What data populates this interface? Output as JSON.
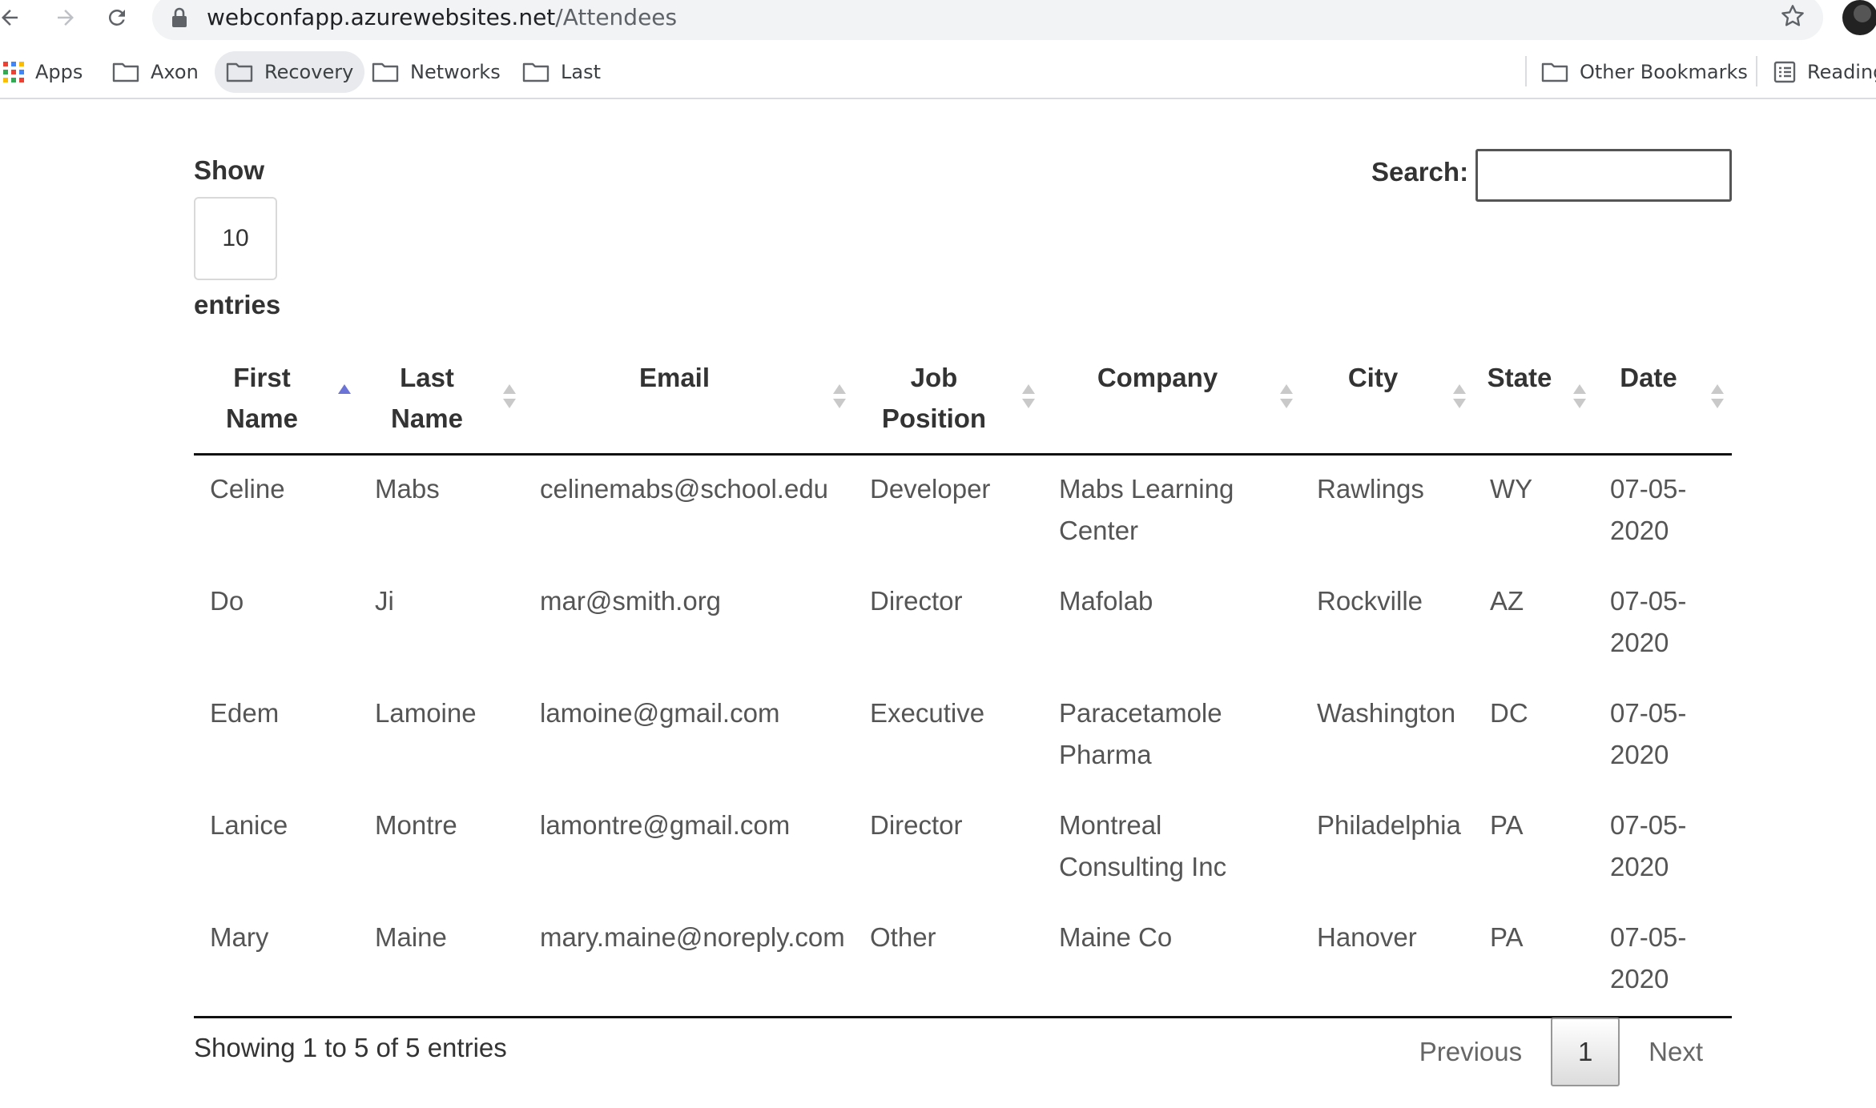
{
  "browser": {
    "url_host": "webconfapp.azurewebsites.net",
    "url_path": "/Attendees"
  },
  "bookmarks": {
    "items": [
      {
        "label": "Apps",
        "icon": "apps-grid-icon"
      },
      {
        "label": "Axon",
        "icon": "folder-icon"
      },
      {
        "label": "Recovery",
        "icon": "folder-icon"
      },
      {
        "label": "Networks",
        "icon": "folder-icon"
      },
      {
        "label": "Last",
        "icon": "folder-icon"
      }
    ],
    "other_bookmarks": "Other Bookmarks",
    "reading_list": "Reading List"
  },
  "datatable": {
    "show_label": "Show",
    "entries_label": "entries",
    "page_length": "10",
    "search_label": "Search:",
    "search_value": "",
    "columns": [
      "First Name",
      "Last Name",
      "Email",
      "Job Position",
      "Company",
      "City",
      "State",
      "Date"
    ],
    "sorted_column": "First Name",
    "sort_direction": "ascending",
    "rows": [
      [
        "Celine",
        "Mabs",
        "celinemabs@school.edu",
        "Developer",
        "Mabs Learning Center",
        "Rawlings",
        "WY",
        "07-05-2020"
      ],
      [
        "Do",
        "Ji",
        "mar@smith.org",
        "Director",
        "Mafolab",
        "Rockville",
        "AZ",
        "07-05-2020"
      ],
      [
        "Edem",
        "Lamoine",
        "lamoine@gmail.com",
        "Executive",
        "Paracetamole Pharma",
        "Washington",
        "DC",
        "07-05-2020"
      ],
      [
        "Lanice",
        "Montre",
        "lamontre@gmail.com",
        "Director",
        "Montreal Consulting Inc",
        "Philadelphia",
        "PA",
        "07-05-2020"
      ],
      [
        "Mary",
        "Maine",
        "mary.maine@noreply.com",
        "Other",
        "Maine Co",
        "Hanover",
        "PA",
        "07-05-2020"
      ]
    ],
    "info": "Showing 1 to 5 of 5 entries",
    "pagination": {
      "previous": "Previous",
      "current_page": "1",
      "next": "Next"
    }
  },
  "colors": {
    "sort_active": "#6b74d6",
    "sort_inactive": "#c9c9c9",
    "header_rule": "#111111"
  }
}
